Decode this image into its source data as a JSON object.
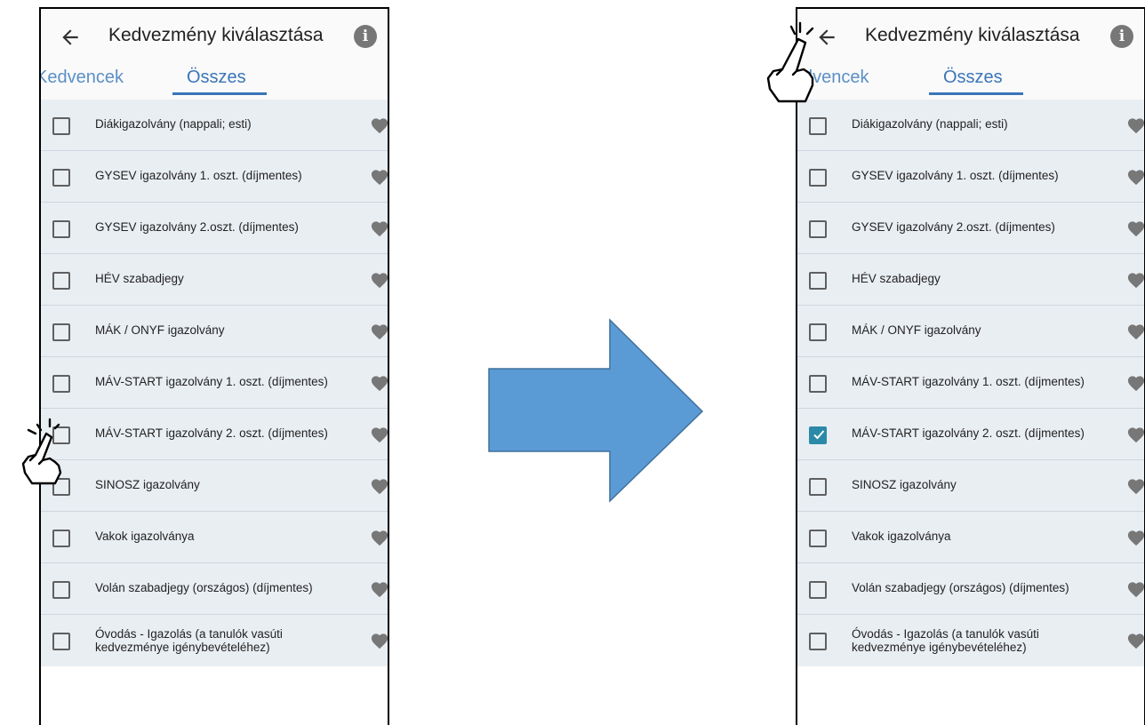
{
  "app": {
    "title": "Kedvezmény kiválasztása",
    "back_icon": "arrow-back-icon",
    "info_icon": "info-icon",
    "info_glyph": "i"
  },
  "tabs": [
    {
      "label": "Kedvencek",
      "selected": false
    },
    {
      "label": "Összes",
      "selected": true
    }
  ],
  "tab_visible_fragments": {
    "left_screen_favorites": "Kedvencek",
    "right_screen_favorites": "dvencek"
  },
  "discounts": [
    {
      "label": "Diákigazolvány (nappali; esti)"
    },
    {
      "label": "GYSEV igazolvány 1. oszt. (díjmentes)"
    },
    {
      "label": "GYSEV igazolvány 2.oszt. (díjmentes)"
    },
    {
      "label": "HÉV szabadjegy"
    },
    {
      "label": "MÁK / ONYF igazolvány"
    },
    {
      "label": "MÁV-START igazolvány 1. oszt. (díjmentes)"
    },
    {
      "label": "MÁV-START igazolvány 2. oszt. (díjmentes)"
    },
    {
      "label": "SINOSZ igazolvány"
    },
    {
      "label": "Vakok igazolványa"
    },
    {
      "label": "Volán szabadjegy (országos) (díjmentes)"
    },
    {
      "label": "Óvodás - Igazolás (a tanulók vasúti kedvezménye igénybevételéhez)"
    }
  ],
  "screens": {
    "before": {
      "checked_index": -1
    },
    "after": {
      "checked_index": 6
    }
  },
  "colors": {
    "accent": "#3a75b8",
    "tab_inactive": "#5b8fc6",
    "list_bg": "#e9eef3",
    "checkbox_checked": "#2a8aa8",
    "heart": "#777777",
    "arrow_fill": "#5b9bd5",
    "arrow_stroke": "#41719c"
  },
  "icons": {
    "heart": "heart-icon",
    "hand": "pointing-hand-icon",
    "transition": "right-arrow-icon"
  }
}
